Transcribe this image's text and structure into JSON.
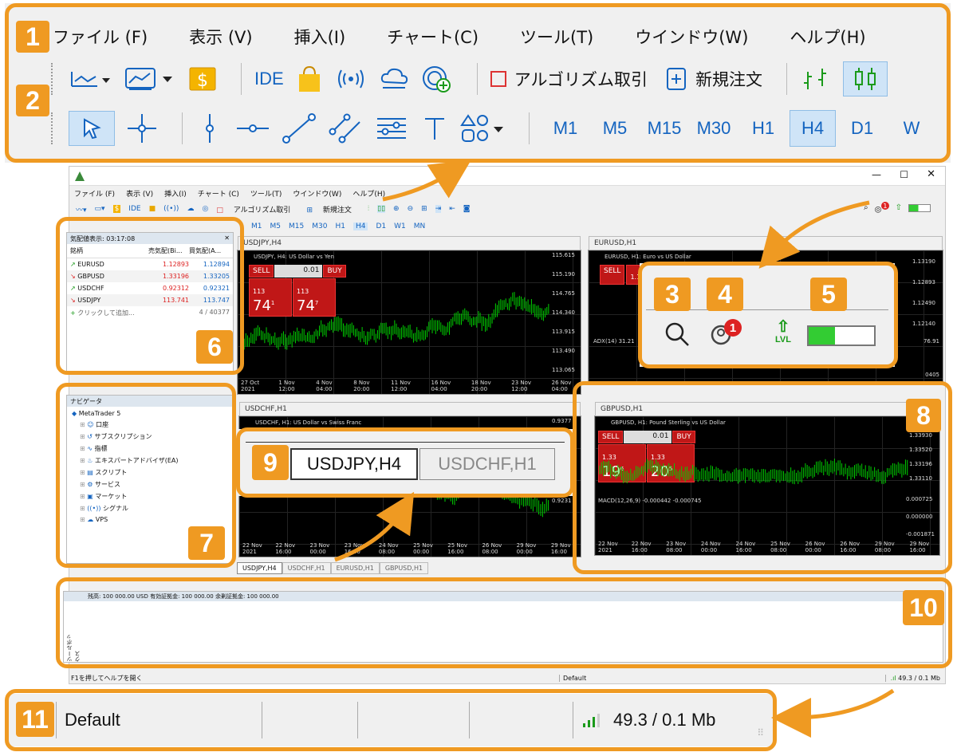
{
  "badges": [
    "1",
    "2",
    "3",
    "4",
    "5",
    "6",
    "7",
    "8",
    "9",
    "10",
    "11"
  ],
  "menu": [
    "ファイル (F)",
    "表示 (V)",
    "挿入(I)",
    "チャート(C)",
    "ツール(T)",
    "ウインドウ(W)",
    "ヘルプ(H)"
  ],
  "toolbar1": {
    "ide": "IDE",
    "algo": "アルゴリズム取引",
    "neworder": "新規注文"
  },
  "timeframes": [
    "M1",
    "M5",
    "M15",
    "M30",
    "H1",
    "H4",
    "D1",
    "W"
  ],
  "mini": {
    "menu": [
      "ファイル (F)",
      "表示 (V)",
      "挿入(I)",
      "チャート (C)",
      "ツール(T)",
      "ウインドウ(W)",
      "ヘルプ(H)"
    ],
    "tb_algo": "アルゴリズム取引",
    "tb_order": "新規注文",
    "tb_ide": "IDE",
    "timeframes": [
      "M1",
      "M5",
      "M15",
      "M30",
      "H1",
      "H4",
      "D1",
      "W1",
      "MN"
    ],
    "notif_count": "1"
  },
  "marketwatch": {
    "title": "気配値表示: 03:17:08",
    "headers": [
      "銘柄",
      "売気配(Bi...",
      "買気配(A..."
    ],
    "rows": [
      {
        "sym": "EURUSD",
        "bid": "1.12893",
        "ask": "1.12894",
        "dir": "up"
      },
      {
        "sym": "GBPUSD",
        "bid": "1.33196",
        "ask": "1.33205",
        "dir": "down"
      },
      {
        "sym": "USDCHF",
        "bid": "0.92312",
        "ask": "0.92321",
        "dir": "up"
      },
      {
        "sym": "USDJPY",
        "bid": "113.741",
        "ask": "113.747",
        "dir": "down"
      }
    ],
    "add": "クリックして追加...",
    "count": "4 / 40377"
  },
  "navigator": {
    "title": "ナビゲータ",
    "items": [
      "MetaTrader 5",
      "口座",
      "サブスクリプション",
      "指標",
      "エキスパートアドバイザ(EA)",
      "スクリプト",
      "サービス",
      "マーケット",
      "シグナル",
      "VPS"
    ]
  },
  "charts": {
    "usdjpy": {
      "title": "USDJPY,H4",
      "label": "USDJPY, H4: US Dollar vs Yen",
      "sell": "SELL",
      "buy": "BUY",
      "lot": "0.01",
      "sellp": "74",
      "buyp": "74",
      "sellpre": "113",
      "buypre": "113",
      "sellsup": "1",
      "buysup": "7",
      "prices": [
        "115.615",
        "115.190",
        "114.765",
        "114.340",
        "113.915",
        "113.490",
        "113.065"
      ],
      "cur": "113.741",
      "dates": [
        "27 Oct 2021",
        "1 Nov 12:00",
        "4 Nov 04:00",
        "8 Nov 20:00",
        "11 Nov 12:00",
        "16 Nov 04:00",
        "18 Nov 20:00",
        "23 Nov 12:00",
        "26 Nov 04:00"
      ]
    },
    "eurusd": {
      "title": "EURUSD,H1",
      "label": "EURUSD, H1: Euro vs US Dollar",
      "sell": "SELL",
      "sellpre": "1.12",
      "sellp": "89",
      "prices": [
        "1.13190",
        "1.12893",
        "1.12490",
        "1.12140"
      ],
      "adx": "ADX(14) 31.21",
      "adxv": "76.91",
      "adxl": "0405"
    },
    "usdchf": {
      "title": "USDCHF,H1",
      "label": "USDCHF, H1: US Dollar vs Swiss Franc",
      "prices": [
        "0.9377",
        "0.9255",
        "0.9231"
      ],
      "dates": [
        "22 Nov 2021",
        "22 Nov 16:00",
        "23 Nov 00:00",
        "23 Nov 16:00",
        "24 Nov 08:00",
        "25 Nov 00:00",
        "25 Nov 16:00",
        "26 Nov 08:00",
        "29 Nov 00:00",
        "29 Nov 16:00"
      ]
    },
    "gbpusd": {
      "title": "GBPUSD,H1",
      "label": "GBPUSD, H1: Pound Sterling vs US Dollar",
      "sell": "SELL",
      "buy": "BUY",
      "lot": "0.01",
      "sellpre": "1.33",
      "sellp": "19",
      "sellsup": "6",
      "buypre": "1.33",
      "buyp": "20",
      "buysup": "5",
      "prices": [
        "1.33930",
        "1.33520",
        "1.33196",
        "1.33110"
      ],
      "macd": "MACD(12,26,9) -0.000442 -0.000745",
      "macdv": [
        "0.000725",
        "0.000000",
        "-0.001871"
      ],
      "dates": [
        "22 Nov 2021",
        "22 Nov 16:00",
        "23 Nov 08:00",
        "24 Nov 00:00",
        "24 Nov 16:00",
        "25 Nov 08:00",
        "26 Nov 00:00",
        "26 Nov 16:00",
        "29 Nov 08:00",
        "29 Nov 16:00"
      ]
    }
  },
  "tabs": [
    "USDJPY,H4",
    "USDCHF,H1",
    "EURUSD,H1",
    "GBPUSD,H1"
  ],
  "toolbox": {
    "summary": "残高: 100 000.00 USD  有効証拠金: 100 000.00  余剰証拠金: 100 000.00",
    "side": "ツールボックス"
  },
  "statusbar": {
    "help": "F1を押してヘルプを開く",
    "profile": "Default",
    "traffic": "49.3 / 0.1 Mb"
  },
  "zoom_tabs": [
    "USDJPY,H4",
    "USDCHF,H1"
  ],
  "zoom_status": {
    "profile": "Default",
    "traffic": "49.3 / 0.1 Mb"
  },
  "zoom_notif": "1",
  "zoom_lvl": "LVL",
  "colors": {
    "orange": "#ef9a22",
    "accent": "#1464c0",
    "sell": "#c01717",
    "candle": "#00d000"
  }
}
